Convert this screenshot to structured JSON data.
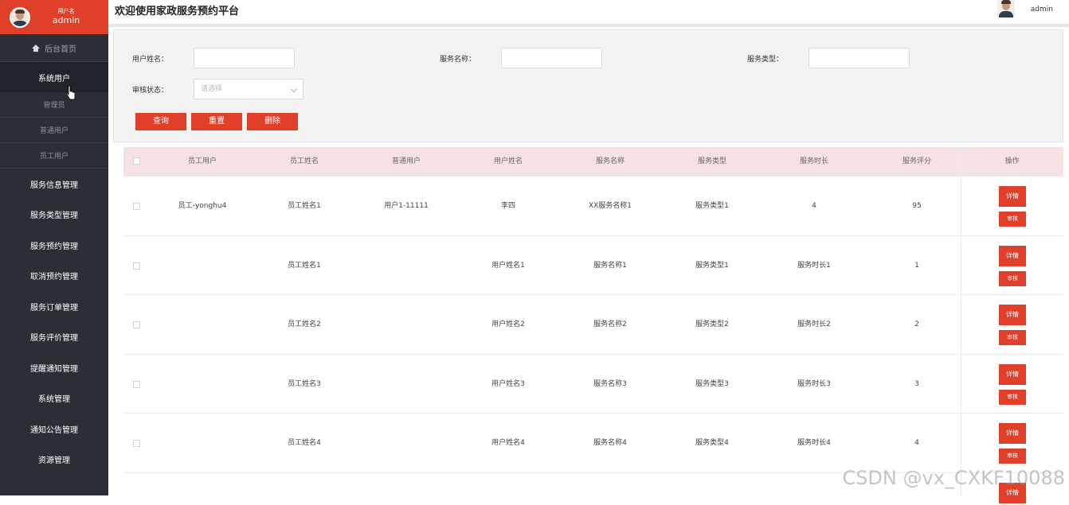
{
  "sidebar": {
    "user_label": "用户名",
    "user_name": "admin",
    "home": "后台首页",
    "system_users": "系统用户",
    "sub_items": [
      "管理员",
      "普通用户",
      "员工用户"
    ],
    "menu": [
      "服务信息管理",
      "服务类型管理",
      "服务预约管理",
      "取消预约管理",
      "服务订单管理",
      "服务评价管理",
      "提醒通知管理",
      "系统管理",
      "通知公告管理",
      "资源管理"
    ]
  },
  "header": {
    "title": "欢迎使用家政服务预约平台",
    "user": "admin"
  },
  "search": {
    "username_label": "用户姓名：",
    "service_name_label": "服务名称：",
    "service_type_label": "服务类型：",
    "audit_label": "审核状态：",
    "audit_placeholder": "请选择",
    "query": "查询",
    "reset": "重置",
    "delete": "删除"
  },
  "table": {
    "headers": [
      "员工用户",
      "员工姓名",
      "普通用户",
      "用户姓名",
      "服务名称",
      "服务类型",
      "服务时长",
      "服务评分",
      "操作"
    ],
    "rows": [
      [
        "员工-yonghu4",
        "员工姓名1",
        "用户1-11111",
        "李四",
        "XX服务名称1",
        "服务类型1",
        "4",
        "95"
      ],
      [
        "",
        "员工姓名1",
        "",
        "用户姓名1",
        "服务名称1",
        "服务类型1",
        "服务时长1",
        "1"
      ],
      [
        "",
        "员工姓名2",
        "",
        "用户姓名2",
        "服务名称2",
        "服务类型2",
        "服务时长2",
        "2"
      ],
      [
        "",
        "员工姓名3",
        "",
        "用户姓名3",
        "服务名称3",
        "服务类型3",
        "服务时长3",
        "3"
      ],
      [
        "",
        "员工姓名4",
        "",
        "用户姓名4",
        "服务名称4",
        "服务类型4",
        "服务时长4",
        "4"
      ]
    ],
    "detail": "详情",
    "audit": "审核"
  },
  "watermark": "CSDN @vx_CXKF10088",
  "colors": {
    "accent": "#e0402a",
    "sidebar": "#2b2f35",
    "table_header": "#f6e2e2"
  }
}
